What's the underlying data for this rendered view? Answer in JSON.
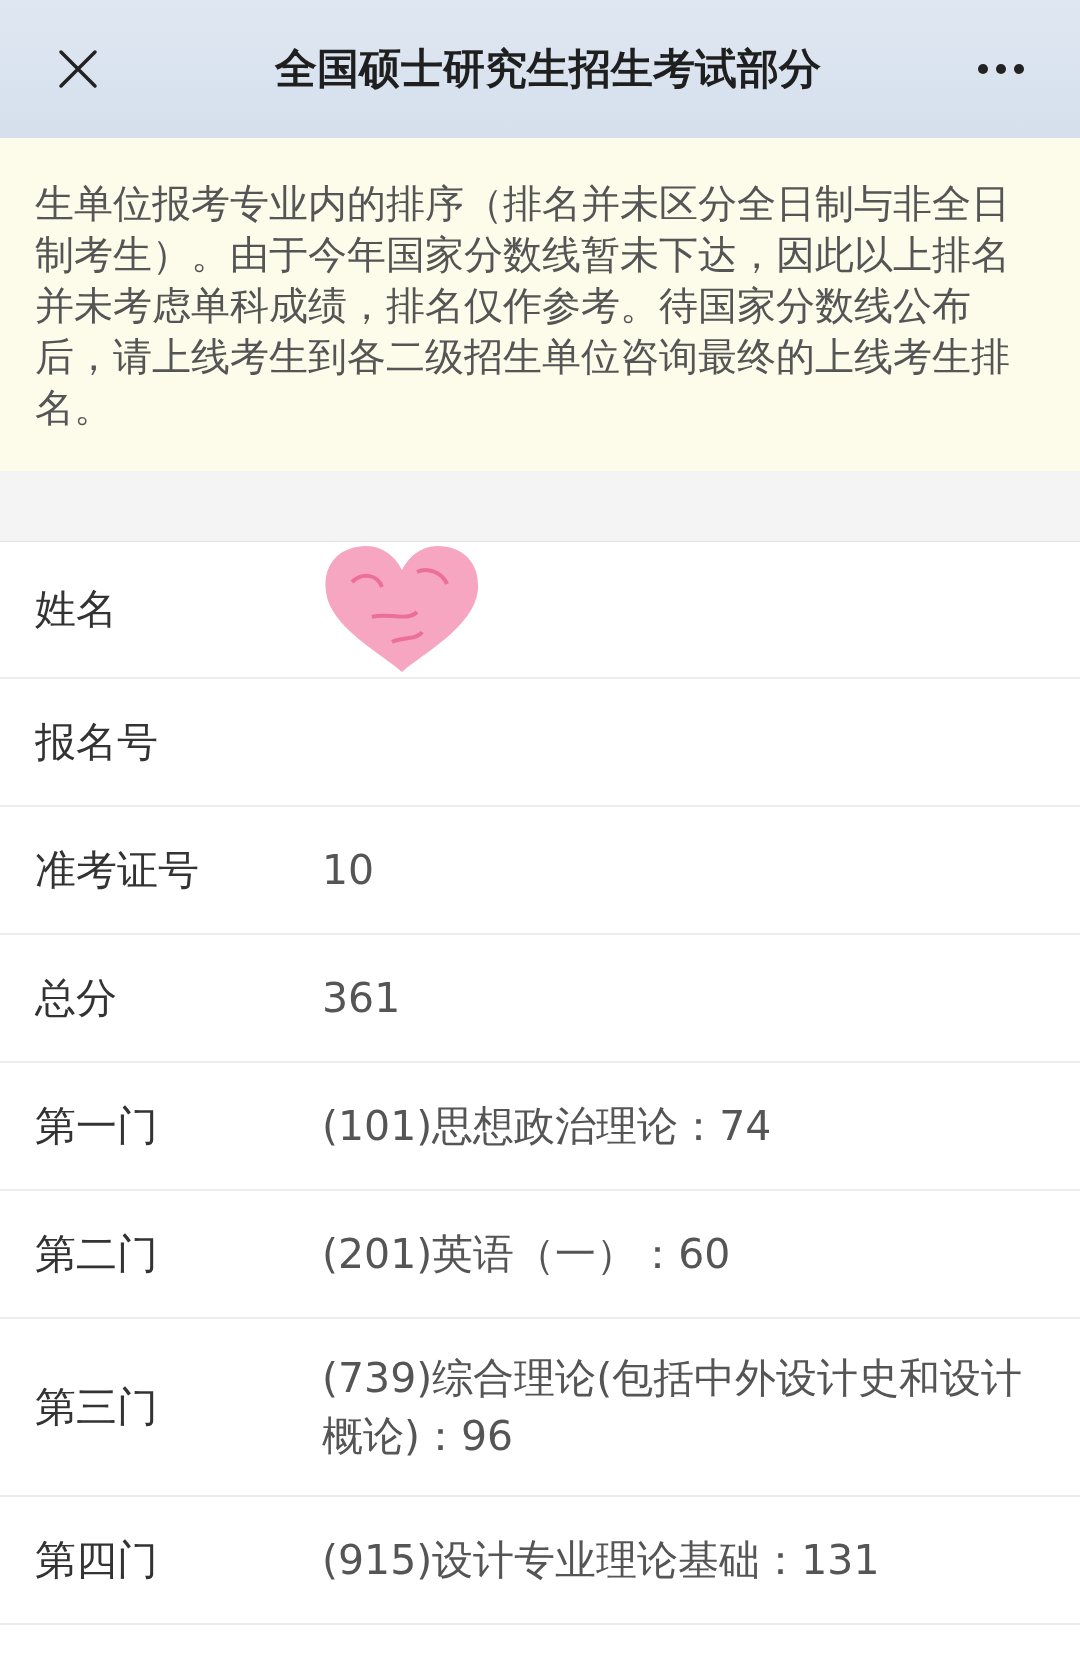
{
  "header": {
    "title": "全国硕士研究生招生考试部分"
  },
  "notice": {
    "text": "生单位报考专业内的排序（排名并未区分全日制与非全日制考生）。由于今年国家分数线暂未下达，因此以上排名并未考虑单科成绩，排名仅作参考。待国家分数线公布后，请上线考生到各二级招生单位咨询最终的上线考生排名。"
  },
  "rows": [
    {
      "label": "姓名",
      "kind": "sticker"
    },
    {
      "label": "报名号",
      "kind": "hidden"
    },
    {
      "label": "准考证号",
      "kind": "text",
      "value": "10"
    },
    {
      "label": "总分",
      "kind": "text",
      "value": "361"
    },
    {
      "label": "第一门",
      "kind": "text",
      "value": "(101)思想政治理论：74"
    },
    {
      "label": "第二门",
      "kind": "text",
      "value": "(201)英语（一）：60"
    },
    {
      "label": "第三门",
      "kind": "text",
      "value": "(739)综合理论(包括中外设计史和设计概论)：96"
    },
    {
      "label": "第四门",
      "kind": "text",
      "value": "(915)设计专业理论基础：131"
    }
  ]
}
